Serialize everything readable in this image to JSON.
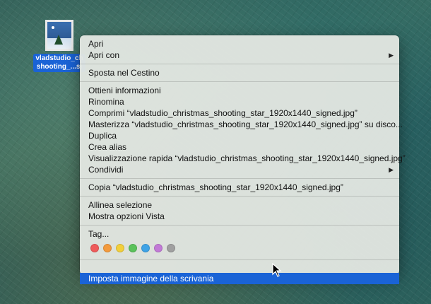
{
  "desktop_icon": {
    "name_line1": "vladstudio_ch",
    "name_line2": "shooting_...si",
    "icon": "image-thumbnail-icon"
  },
  "context_menu": {
    "groups": [
      [
        {
          "label": "Apri",
          "submenu": false
        },
        {
          "label": "Apri con",
          "submenu": true
        }
      ],
      [
        {
          "label": "Sposta nel Cestino",
          "submenu": false
        }
      ],
      [
        {
          "label": "Ottieni informazioni",
          "submenu": false
        },
        {
          "label": "Rinomina",
          "submenu": false
        },
        {
          "label": "Comprimi “vladstudio_christmas_shooting_star_1920x1440_signed.jpg”",
          "submenu": false
        },
        {
          "label": "Masterizza “vladstudio_christmas_shooting_star_1920x1440_signed.jpg” su disco...",
          "submenu": false
        },
        {
          "label": "Duplica",
          "submenu": false
        },
        {
          "label": "Crea alias",
          "submenu": false
        },
        {
          "label": "Visualizzazione rapida “vladstudio_christmas_shooting_star_1920x1440_signed.jpg”",
          "submenu": false
        },
        {
          "label": "Condividi",
          "submenu": true
        }
      ],
      [
        {
          "label": "Copia “vladstudio_christmas_shooting_star_1920x1440_signed.jpg”",
          "submenu": false
        }
      ],
      [
        {
          "label": "Allinea selezione",
          "submenu": false
        },
        {
          "label": "Mostra opzioni Vista",
          "submenu": false
        }
      ]
    ],
    "tags_label": "Tag...",
    "tag_colors": [
      "#ef5b5b",
      "#f39a3c",
      "#f2cf3b",
      "#5ac25a",
      "#3fa3e6",
      "#c27ad6",
      "#a0a0a0"
    ],
    "highlighted_item": "Imposta immagine della scrivania",
    "submenu_arrow_icon": "triangle-right-icon",
    "accent_color": "#1a63d6"
  },
  "cursor": {
    "icon": "arrow-pointer-icon"
  }
}
